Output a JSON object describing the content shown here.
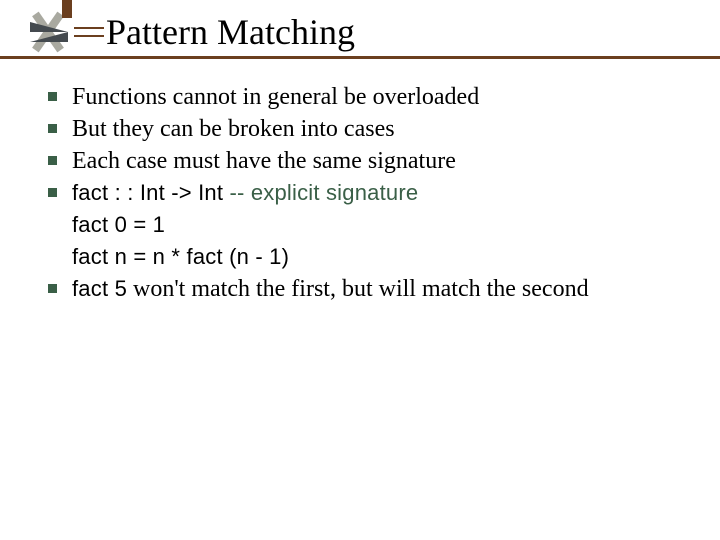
{
  "title": "Pattern Matching",
  "bullets": {
    "b1": "Functions cannot in general be overloaded",
    "b2": "But they can be broken into cases",
    "b3": "Each case must have the same signature",
    "b4_code": "fact : : Int -> Int",
    "b4_comment": "  -- explicit signature",
    "b4_line2": "fact 0 = 1",
    "b4_line3": "fact n = n * fact (n - 1)",
    "b5_code": "fact 5",
    "b5_rest": " won't match the first, but will match the second"
  },
  "colors": {
    "accent_brown": "#6b3f1f",
    "bullet_green": "#3a5f47",
    "logo_grey": "#444a4f"
  }
}
